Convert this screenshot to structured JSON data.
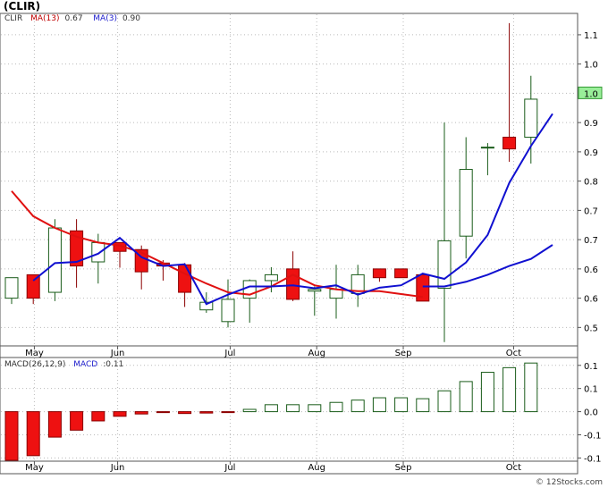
{
  "chart_data": [
    {
      "type": "candlestick",
      "title": "(CLIR)",
      "legend": [
        {
          "name": "CLIR",
          "color": "#000000"
        },
        {
          "name": "MA(13)",
          "value": "0.67",
          "color": "#e01010"
        },
        {
          "name": "MA(3)",
          "value": "0.90",
          "color": "#1010d0"
        }
      ],
      "x_tick_labels": [
        "May",
        "Jun",
        "Jul",
        "Aug",
        "Sep",
        "Oct"
      ],
      "y_tick_labels": [
        "1.1",
        "1.0",
        "1.0",
        "0.9",
        "0.9",
        "0.8",
        "0.7",
        "0.7",
        "0.6",
        "0.6",
        "0.5"
      ],
      "y_tick_values": [
        1.1,
        1.05,
        1.0,
        0.95,
        0.9,
        0.85,
        0.8,
        0.75,
        0.7,
        0.65,
        0.6
      ],
      "last_price_label": "1.0",
      "ylim": [
        0.57,
        1.135
      ],
      "grid": true,
      "candles": [
        {
          "o": 0.65,
          "h": 0.685,
          "l": 0.64,
          "c": 0.685
        },
        {
          "o": 0.69,
          "h": 0.69,
          "l": 0.64,
          "c": 0.65
        },
        {
          "o": 0.66,
          "h": 0.785,
          "l": 0.645,
          "c": 0.77
        },
        {
          "o": 0.765,
          "h": 0.785,
          "l": 0.668,
          "c": 0.705
        },
        {
          "o": 0.712,
          "h": 0.76,
          "l": 0.675,
          "c": 0.745
        },
        {
          "o": 0.745,
          "h": 0.745,
          "l": 0.702,
          "c": 0.73
        },
        {
          "o": 0.733,
          "h": 0.74,
          "l": 0.665,
          "c": 0.695
        },
        {
          "o": 0.71,
          "h": 0.715,
          "l": 0.68,
          "c": 0.705
        },
        {
          "o": 0.707,
          "h": 0.71,
          "l": 0.635,
          "c": 0.66
        },
        {
          "o": 0.63,
          "h": 0.66,
          "l": 0.625,
          "c": 0.643
        },
        {
          "o": 0.61,
          "h": 0.682,
          "l": 0.6,
          "c": 0.648
        },
        {
          "o": 0.65,
          "h": 0.682,
          "l": 0.608,
          "c": 0.68
        },
        {
          "o": 0.68,
          "h": 0.703,
          "l": 0.66,
          "c": 0.69
        },
        {
          "o": 0.7,
          "h": 0.73,
          "l": 0.645,
          "c": 0.648
        },
        {
          "o": 0.662,
          "h": 0.67,
          "l": 0.62,
          "c": 0.665
        },
        {
          "o": 0.65,
          "h": 0.707,
          "l": 0.615,
          "c": 0.665
        },
        {
          "o": 0.658,
          "h": 0.707,
          "l": 0.635,
          "c": 0.69
        },
        {
          "o": 0.7,
          "h": 0.7,
          "l": 0.678,
          "c": 0.685
        },
        {
          "o": 0.7,
          "h": 0.7,
          "l": 0.69,
          "c": 0.685
        },
        {
          "o": 0.69,
          "h": 0.69,
          "l": 0.645,
          "c": 0.645
        },
        {
          "o": 0.667,
          "h": 0.95,
          "l": 0.575,
          "c": 0.748
        },
        {
          "o": 0.756,
          "h": 0.925,
          "l": 0.718,
          "c": 0.87
        },
        {
          "o": 0.908,
          "h": 0.915,
          "l": 0.86,
          "c": 0.908
        },
        {
          "o": 0.925,
          "h": 1.12,
          "l": 0.883,
          "c": 0.905
        },
        {
          "o": 0.925,
          "h": 1.03,
          "l": 0.88,
          "c": 0.99
        }
      ],
      "ma13": [
        0.833,
        0.79,
        0.77,
        0.755,
        0.745,
        0.74,
        0.728,
        0.71,
        0.692,
        0.675,
        0.66,
        0.656,
        0.67,
        0.69,
        0.672,
        0.665,
        0.662,
        0.662,
        0.657,
        0.652
      ],
      "ma3": [
        0.68,
        0.71,
        0.712,
        0.726,
        0.753,
        0.72,
        0.705,
        0.708,
        0.64,
        0.656,
        0.67,
        0.67,
        0.672,
        0.667,
        0.672,
        0.656,
        0.668,
        0.672,
        0.692,
        0.683,
        0.711,
        0.758,
        0.847,
        0.91,
        0.965
      ],
      "ma3_lower": [
        0.67,
        0.67,
        0.678,
        0.69,
        0.705,
        0.717,
        0.741
      ],
      "lower_line_start_index": 19
    },
    {
      "type": "bar",
      "title": "MACD(26,12,9)",
      "legend": [
        {
          "name": "MACD",
          "value": "0.11",
          "color": "#1010d0"
        }
      ],
      "x_tick_labels": [
        "May",
        "Jun",
        "Jul",
        "Aug",
        "Sep",
        "Oct"
      ],
      "y_tick_labels": [
        "0.1",
        "0.1",
        "0.0",
        "-0.1",
        "-0.1"
      ],
      "y_tick_values": [
        0.1,
        0.05,
        0.0,
        -0.05,
        -0.1
      ],
      "ylim": [
        -0.105,
        0.115
      ],
      "values": [
        -0.105,
        -0.095,
        -0.055,
        -0.04,
        -0.02,
        -0.01,
        -0.005,
        -0.002,
        -0.004,
        -0.003,
        -0.002,
        0.005,
        0.015,
        0.015,
        0.015,
        0.02,
        0.025,
        0.03,
        0.03,
        0.028,
        0.045,
        0.065,
        0.085,
        0.095,
        0.105
      ]
    }
  ],
  "watermark": "© 12Stocks.com"
}
